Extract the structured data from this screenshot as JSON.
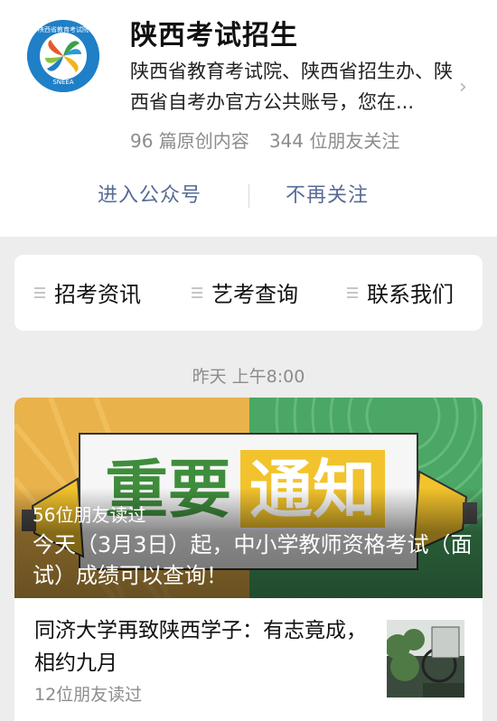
{
  "account": {
    "name": "陕西考试招生",
    "description": "陕西省教育考试院、陕西省招生办、陕西省自考办官方公共账号，您在...",
    "original_count": "96 篇原创内容",
    "followers": "344 位朋友关注",
    "logo_text_top": "陕西省教育考试院",
    "logo_text_bottom": "SNEEA"
  },
  "actions": {
    "enter": "进入公众号",
    "unfollow": "不再关注"
  },
  "menu": [
    {
      "label": "招考资讯"
    },
    {
      "label": "艺考查询"
    },
    {
      "label": "联系我们"
    }
  ],
  "feed": {
    "date": "昨天 上午8:00",
    "main_article": {
      "cover_text_1": "重要",
      "cover_text_2": "通知",
      "reads": "56位朋友读过",
      "title": "今天（3月3日）起，中小学教师资格考试（面试）成绩可以查询！"
    },
    "second_article": {
      "title": "同济大学再致陕西学子：有志竟成，相约九月",
      "reads": "12位朋友读过"
    }
  },
  "colors": {
    "link": "#576b95",
    "cover_orange": "#e9b24a",
    "cover_green": "#4aa765",
    "notice_green": "#3f8d3c",
    "notice_yellow": "#f2c32c",
    "logo_blue": "#1f7fc7"
  }
}
